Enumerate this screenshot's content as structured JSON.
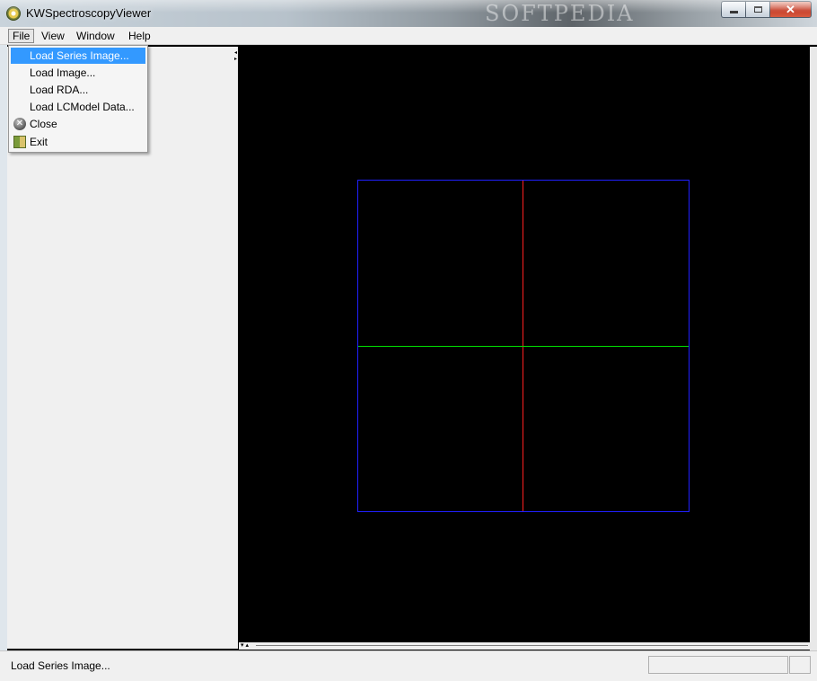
{
  "window": {
    "title": "KWSpectroscopyViewer",
    "watermark": "SOFTPEDIA",
    "close_glyph": "✕"
  },
  "menubar": {
    "items": [
      "File",
      "View",
      "Window",
      "Help"
    ]
  },
  "file_menu": {
    "items": [
      {
        "label": "Load Series Image...",
        "selected": true,
        "icon": ""
      },
      {
        "label": "Load Image...",
        "icon": ""
      },
      {
        "label": "Load RDA...",
        "icon": ""
      },
      {
        "label": "Load LCModel Data...",
        "icon": ""
      },
      {
        "label": "Close",
        "icon": "close-icon"
      },
      {
        "label": "Exit",
        "icon": "exit-icon"
      }
    ]
  },
  "viewport": {
    "background": "#000000",
    "box_color": "#2020ff",
    "vertical_color": "#ff2020",
    "horizontal_color": "#00e000"
  },
  "statusbar": {
    "text": "Load Series Image..."
  },
  "colors": {
    "highlight": "#3399ff",
    "panel": "#f0f0f0"
  }
}
